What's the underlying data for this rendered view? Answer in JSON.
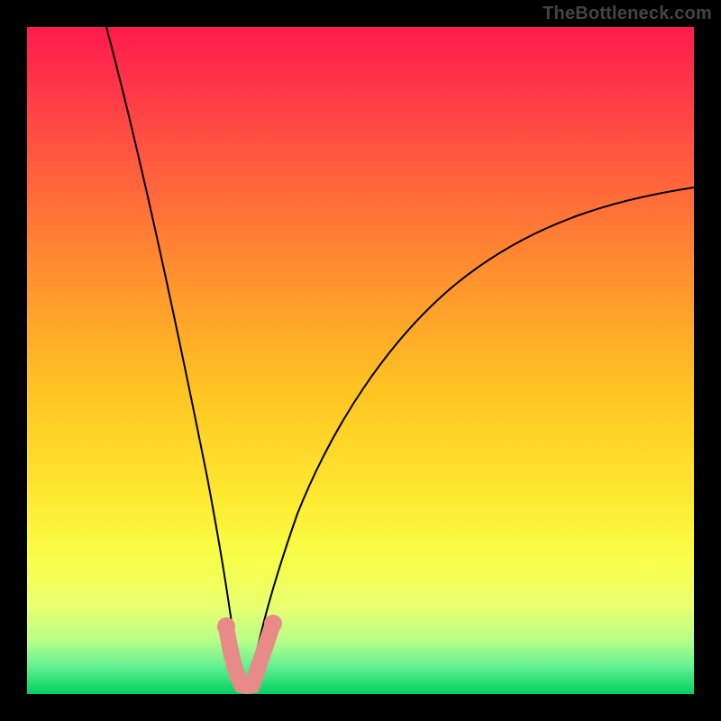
{
  "watermark": "TheBottleneck.com",
  "chart_data": {
    "type": "line",
    "title": "",
    "xlabel": "",
    "ylabel": "",
    "xlim": [
      0,
      100
    ],
    "ylim": [
      0,
      100
    ],
    "grid": false,
    "legend": false,
    "background_gradient": {
      "stops": [
        {
          "pos": 0,
          "color": "#ff1a4d"
        },
        {
          "pos": 10,
          "color": "#ff3a47"
        },
        {
          "pos": 25,
          "color": "#ff6a3a"
        },
        {
          "pos": 40,
          "color": "#ff9a2c"
        },
        {
          "pos": 55,
          "color": "#ffc522"
        },
        {
          "pos": 70,
          "color": "#ffe830"
        },
        {
          "pos": 80,
          "color": "#f8ff4a"
        },
        {
          "pos": 87,
          "color": "#e8ff70"
        },
        {
          "pos": 92,
          "color": "#b8ff88"
        },
        {
          "pos": 96,
          "color": "#60f090"
        },
        {
          "pos": 100,
          "color": "#00d060"
        }
      ]
    },
    "series": [
      {
        "name": "left-curve",
        "x": [
          12,
          15,
          18,
          21,
          24,
          26,
          28,
          29.5,
          30.5,
          31,
          31.5,
          31.8
        ],
        "y": [
          100,
          82,
          64,
          48,
          32,
          20,
          12,
          6,
          3,
          1.5,
          0.7,
          0.2
        ]
      },
      {
        "name": "right-curve",
        "x": [
          33.5,
          34,
          35,
          36,
          38,
          41,
          45,
          50,
          56,
          63,
          72,
          82,
          92,
          100
        ],
        "y": [
          0.2,
          0.7,
          2,
          4,
          8,
          14,
          22,
          31,
          40,
          49,
          58,
          66,
          72,
          76
        ]
      }
    ],
    "markers": [
      {
        "name": "left-handle",
        "path_x": [
          30,
          30.5,
          31.5,
          32.5
        ],
        "path_y": [
          9,
          4,
          1,
          0.5
        ],
        "dot": {
          "x": 30,
          "y": 10
        }
      },
      {
        "name": "right-handle",
        "path_x": [
          32.7,
          33.5,
          34.5,
          35.5,
          36.5
        ],
        "path_y": [
          0.5,
          1,
          2.5,
          5,
          9
        ],
        "dot": {
          "x": 36.8,
          "y": 10
        }
      }
    ],
    "minimum": {
      "x": 32.6,
      "y": 0
    }
  }
}
